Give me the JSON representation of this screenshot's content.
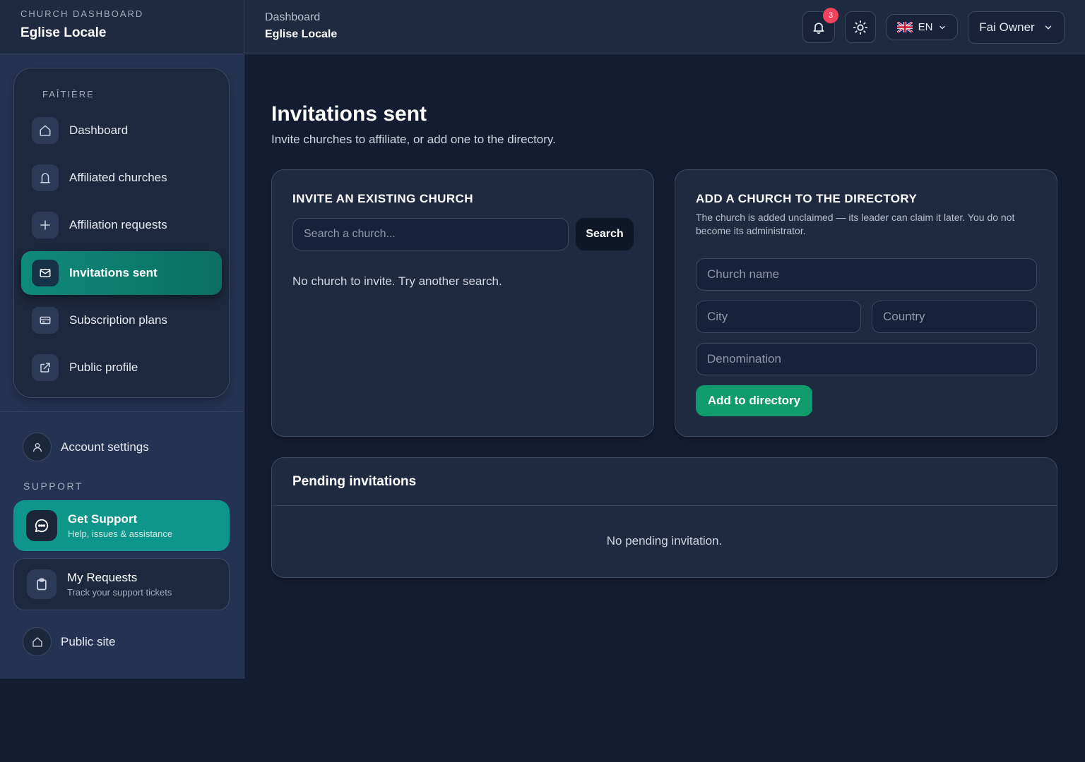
{
  "brand": {
    "kicker": "CHURCH DASHBOARD",
    "name": "Eglise Locale"
  },
  "nav": {
    "kicker": "FAÎTIÈRE",
    "items": [
      {
        "label": "Dashboard",
        "icon": "home-icon"
      },
      {
        "label": "Affiliated churches",
        "icon": "church-icon"
      },
      {
        "label": "Affiliation requests",
        "icon": "plus-icon"
      },
      {
        "label": "Invitations sent",
        "icon": "mail-icon",
        "active": true
      },
      {
        "label": "Subscription plans",
        "icon": "credit-card-icon"
      },
      {
        "label": "Public profile",
        "icon": "external-link-icon"
      }
    ]
  },
  "account": {
    "label": "Account settings"
  },
  "support": {
    "kicker": "SUPPORT",
    "get_support": {
      "title": "Get Support",
      "subtitle": "Help, issues & assistance"
    },
    "my_requests": {
      "title": "My Requests",
      "subtitle": "Track your support tickets"
    }
  },
  "public_site": {
    "label": "Public site"
  },
  "topbar": {
    "breadcrumb": "Dashboard",
    "title": "Eglise Locale",
    "notifications_count": "3",
    "language": "EN",
    "user_name": "Fai Owner"
  },
  "page": {
    "title": "Invitations sent",
    "subtitle": "Invite churches to affiliate, or add one to the directory."
  },
  "invite": {
    "heading": "INVITE AN EXISTING CHURCH",
    "search_placeholder": "Search a church...",
    "search_button": "Search",
    "empty": "No church to invite. Try another search."
  },
  "add": {
    "heading": "ADD A CHURCH TO THE DIRECTORY",
    "description": "The church is added unclaimed — its leader can claim it later. You do not become its administrator.",
    "name_placeholder": "Church name",
    "city_placeholder": "City",
    "country_placeholder": "Country",
    "denomination_placeholder": "Denomination",
    "button": "Add to directory"
  },
  "pending": {
    "heading": "Pending invitations",
    "empty": "No pending invitation."
  },
  "colors": {
    "background": "#131d31",
    "sidebar": "#243351",
    "accent_teal": "#0f968a",
    "accent_green": "#0f9b6b",
    "badge": "#f0425c"
  }
}
